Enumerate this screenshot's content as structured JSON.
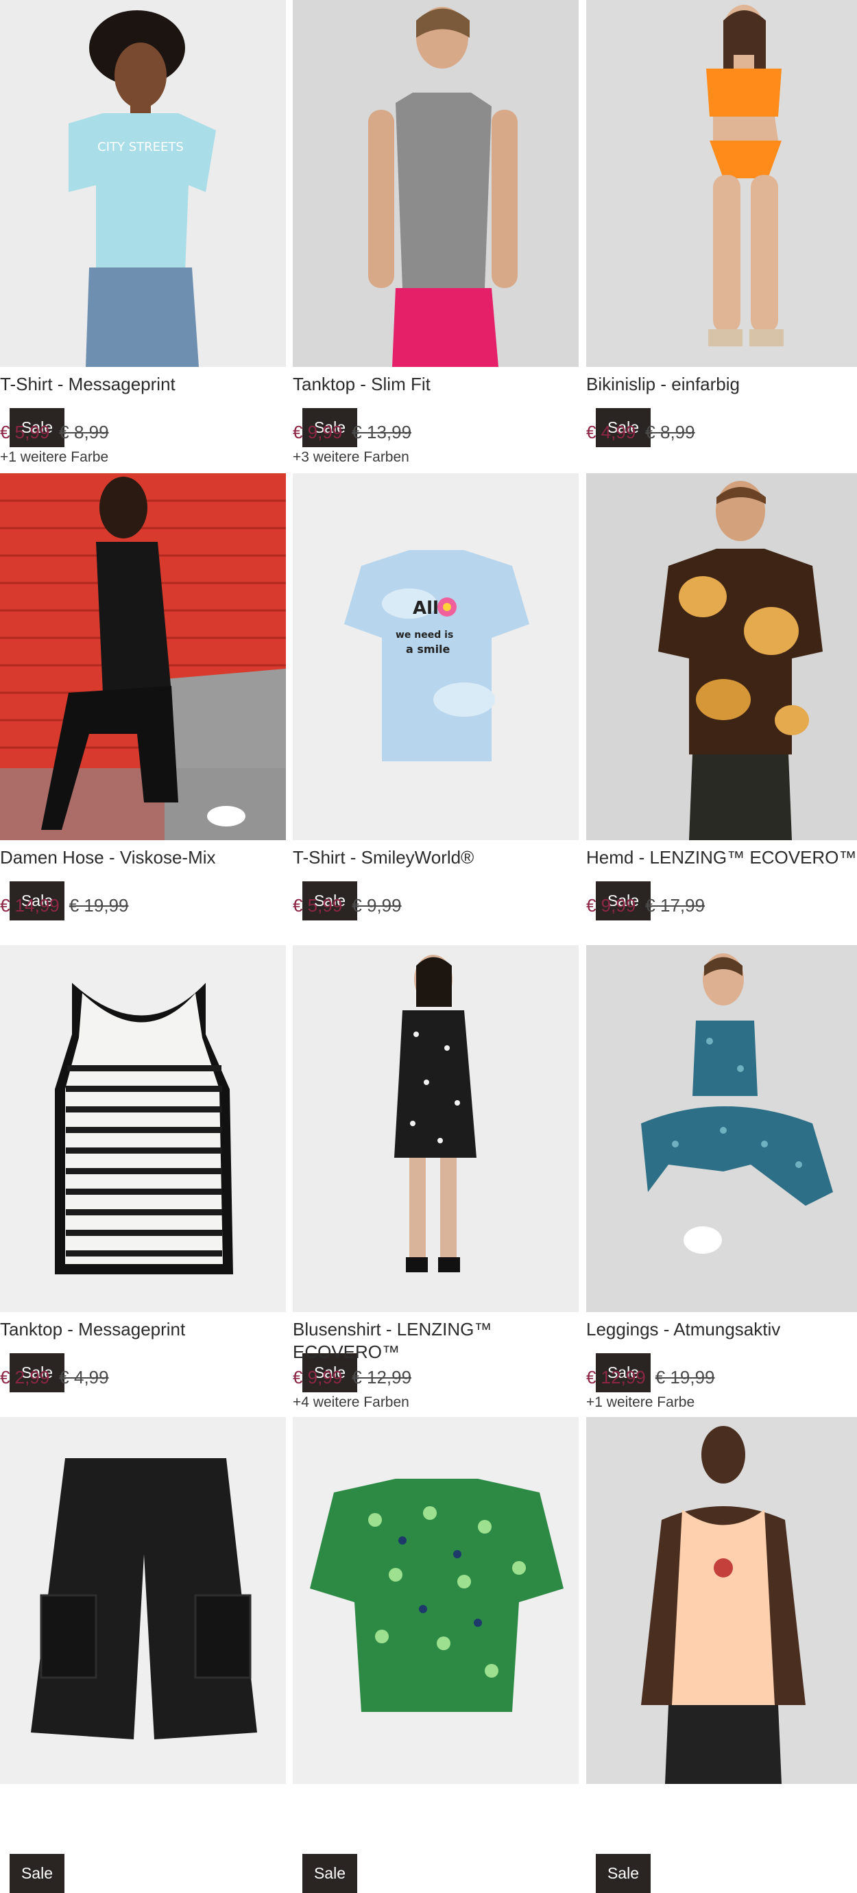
{
  "badge_label": "Sale",
  "colors": {
    "sale_price": "#8d2645",
    "badge_bg": "#2a2522",
    "image_bg": "#ebebeb"
  },
  "products": [
    {
      "name": "T-Shirt - Messageprint",
      "price": "€ 5,99",
      "old_price": "€ 8,99",
      "more_colors": "+1 weitere Farbe"
    },
    {
      "name": "Tanktop - Slim Fit",
      "price": "€ 9,99",
      "old_price": "€ 13,99",
      "more_colors": "+3 weitere Farben"
    },
    {
      "name": "Bikinislip - einfarbig",
      "price": "€ 4,99",
      "old_price": "€ 8,99",
      "more_colors": ""
    },
    {
      "name": "Damen Hose - Viskose-Mix",
      "price": "€ 14,99",
      "old_price": "€ 19,99",
      "more_colors": ""
    },
    {
      "name": "T-Shirt - SmileyWorld®",
      "price": "€ 5,99",
      "old_price": "€ 9,99",
      "more_colors": ""
    },
    {
      "name": "Hemd - LENZING™ ECOVERO™",
      "price": "€ 9,99",
      "old_price": "€ 17,99",
      "more_colors": ""
    },
    {
      "name": "Tanktop - Messageprint",
      "price": "€ 2,99",
      "old_price": "€ 4,99",
      "more_colors": ""
    },
    {
      "name": "Blusenshirt - LENZING™ ECOVERO™",
      "price": "€ 9,99",
      "old_price": "€ 12,99",
      "more_colors": "+4 weitere Farben"
    },
    {
      "name": "Leggings - Atmungsaktiv",
      "price": "€ 12,99",
      "old_price": "€ 19,99",
      "more_colors": "+1 weitere Farbe"
    },
    {
      "name": "",
      "price": "",
      "old_price": "",
      "more_colors": ""
    },
    {
      "name": "",
      "price": "",
      "old_price": "",
      "more_colors": ""
    },
    {
      "name": "",
      "price": "",
      "old_price": "",
      "more_colors": ""
    }
  ]
}
